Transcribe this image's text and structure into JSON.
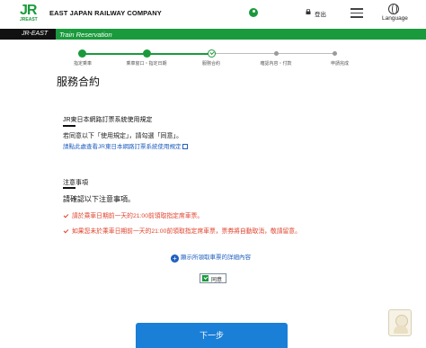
{
  "header": {
    "logo_text": "JR",
    "logo_sub": "JREAST",
    "brand": "EAST JAPAN RAILWAY COMPANY",
    "logout_label": "登出",
    "language_label": "Language",
    "icons": [
      "user-icon",
      "lock-icon",
      "menu-icon",
      "globe-icon"
    ]
  },
  "title_bar": {
    "jr_label": "JR-EAST",
    "section_title": "Train Reservation"
  },
  "steps": [
    {
      "label": "指定乘車",
      "state": "done"
    },
    {
      "label": "乘車窗口・指定日期",
      "state": "done"
    },
    {
      "label": "服務合約",
      "state": "current"
    },
    {
      "label": "確認內容・付款",
      "state": "todo"
    },
    {
      "label": "申請完成",
      "state": "todo"
    }
  ],
  "page_title": "服務合約",
  "terms": {
    "title": "JR東日本網路訂票系統使用規定",
    "instruction": "若同意以下「使用規定」，請勾選「同意」。",
    "link": "請點此處查看JR東日本網路訂票系統使用規定"
  },
  "notes": {
    "title": "注意事項",
    "confirm_heading": "請確認以下注意事項。",
    "warnings": [
      "請於乘車日期前一天的21:00前領取指定席車票。",
      "如果您未於乘車日期前一天的21:00前領取指定席車票，票券將自動取消，敬請留意。"
    ]
  },
  "expand_label": "顯示所領取車票的詳細內容",
  "agree_label": "同意",
  "agree_checked": true,
  "next_button": "下一步",
  "colors": {
    "brand_green": "#1a9a3c",
    "button_blue": "#1a7fd6",
    "link_blue": "#1f5fbf",
    "warning_red": "#e0412b"
  }
}
